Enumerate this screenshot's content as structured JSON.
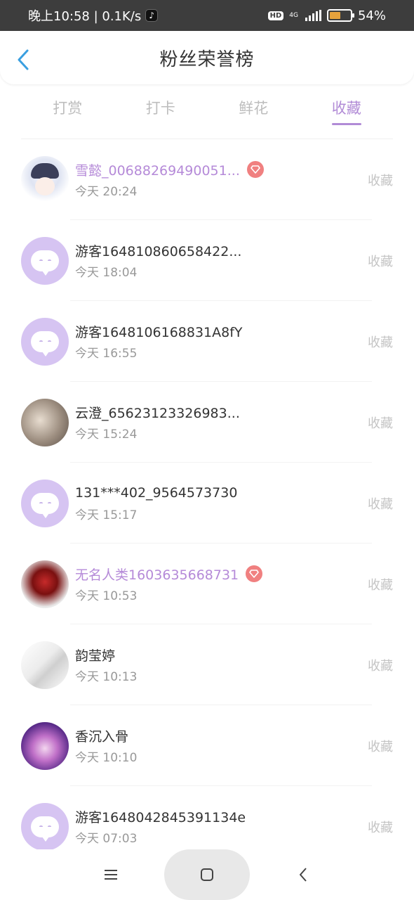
{
  "status_bar": {
    "time_net": "晚上10:58 | 0.1K/s",
    "hd": "HD",
    "network": "4G",
    "battery_level": 0.54,
    "battery_text": "54%"
  },
  "header": {
    "title": "粉丝荣誉榜"
  },
  "tabs": [
    {
      "label": "打赏",
      "active": false
    },
    {
      "label": "打卡",
      "active": false
    },
    {
      "label": "鲜花",
      "active": false
    },
    {
      "label": "收藏",
      "active": true
    }
  ],
  "rows": [
    {
      "name": "雪懿_00688269490051...",
      "time": "今天 20:24",
      "action": "收藏",
      "vip": true,
      "avatar": "anime-girl"
    },
    {
      "name": "游客164810860658422...",
      "time": "今天 18:04",
      "action": "收藏",
      "vip": false,
      "avatar": "default-bubble"
    },
    {
      "name": "游客1648106168831A8fY",
      "time": "今天 16:55",
      "action": "收藏",
      "vip": false,
      "avatar": "default-bubble"
    },
    {
      "name": "云澄_65623123326983...",
      "time": "今天 15:24",
      "action": "收藏",
      "vip": false,
      "avatar": "cat-photo"
    },
    {
      "name": "131***402_9564573730",
      "time": "今天 15:17",
      "action": "收藏",
      "vip": false,
      "avatar": "default-bubble"
    },
    {
      "name": "无名人类1603635668731",
      "time": "今天 10:53",
      "action": "收藏",
      "vip": true,
      "avatar": "roses-photo"
    },
    {
      "name": "韵莹婷",
      "time": "今天 10:13",
      "action": "收藏",
      "vip": false,
      "avatar": "sketch"
    },
    {
      "name": "香沉入骨",
      "time": "今天 10:10",
      "action": "收藏",
      "vip": false,
      "avatar": "purple-anime"
    },
    {
      "name": "游客1648042845391134e",
      "time": "今天 07:03",
      "action": "收藏",
      "vip": false,
      "avatar": "default-bubble"
    }
  ],
  "colors": {
    "accent": "#b18bd6",
    "vip_name": "#b58ad8",
    "vip_badge": "#f08080",
    "default_avatar": "#d6c4f2"
  }
}
